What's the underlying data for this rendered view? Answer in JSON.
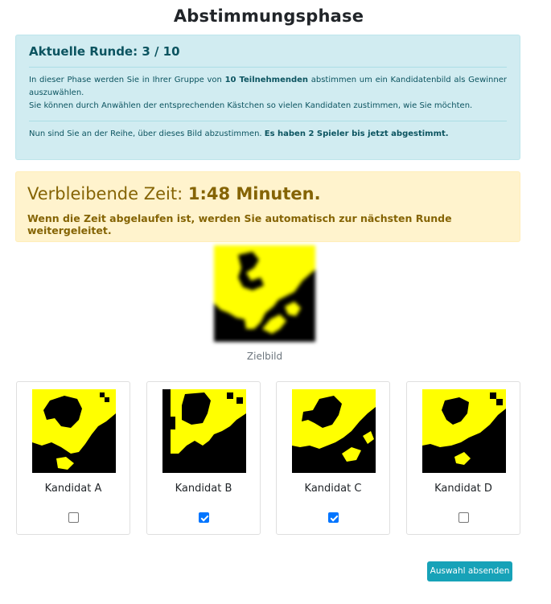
{
  "page": {
    "title": "Abstimmungsphase"
  },
  "info": {
    "round_label": "Aktuelle Runde: 3 / 10",
    "p1_a": "In dieser Phase werden Sie in Ihrer Gruppe von ",
    "p1_b": "10 Teilnehmenden",
    "p1_c": " abstimmen um ein Kandidatenbild als Gewinner auszuwählen.",
    "p2": "Sie können durch Anwählen der entsprechenden Kästchen so vielen Kandidaten zustimmen, wie Sie möchten.",
    "p3_a": "Nun sind Sie an der Reihe, über dieses Bild abzustimmen. ",
    "p3_b": "Es haben 2 Spieler bis jetzt abgestimmt."
  },
  "timer": {
    "label": "Verbleibende Zeit: ",
    "value": "1:48 Minuten.",
    "note": "Wenn die Zeit abgelaufen ist, werden Sie automatisch zur nächsten Runde weitergeleitet."
  },
  "target": {
    "caption": "Zielbild"
  },
  "candidates": [
    {
      "label": "Kandidat A",
      "checked": false
    },
    {
      "label": "Kandidat B",
      "checked": true
    },
    {
      "label": "Kandidat C",
      "checked": true
    },
    {
      "label": "Kandidat D",
      "checked": false
    }
  ],
  "submit_label": "Auswahl absenden",
  "colors": {
    "pixel_on": "#ffff00",
    "pixel_off": "#000000",
    "button": "#17a2b8",
    "checkbox": "#0075ff"
  }
}
